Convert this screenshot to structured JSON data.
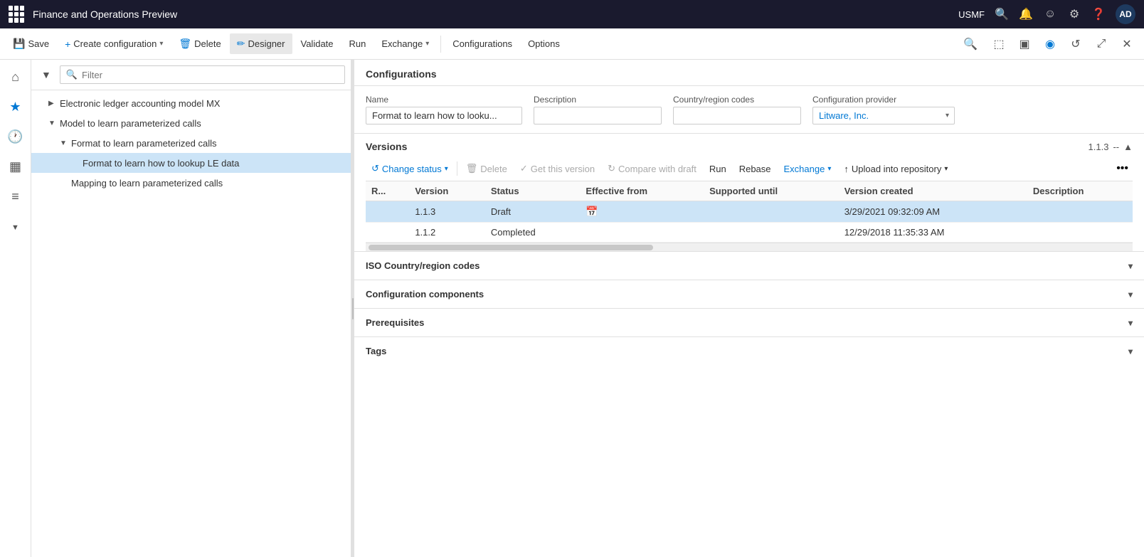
{
  "app": {
    "title": "Finance and Operations Preview",
    "user": "USMF",
    "avatar": "AD"
  },
  "toolbar": {
    "save_label": "Save",
    "create_config_label": "Create configuration",
    "delete_label": "Delete",
    "designer_label": "Designer",
    "validate_label": "Validate",
    "run_label": "Run",
    "exchange_label": "Exchange",
    "configurations_label": "Configurations",
    "options_label": "Options"
  },
  "nav": {
    "filter_placeholder": "Filter",
    "tree": [
      {
        "id": "electronic-ledger",
        "label": "Electronic ledger accounting model MX",
        "level": 1,
        "expanded": false,
        "selected": false
      },
      {
        "id": "model-learn",
        "label": "Model to learn parameterized calls",
        "level": 1,
        "expanded": true,
        "selected": false
      },
      {
        "id": "format-learn",
        "label": "Format to learn parameterized calls",
        "level": 2,
        "expanded": true,
        "selected": false
      },
      {
        "id": "format-lookup",
        "label": "Format to learn how to lookup LE data",
        "level": 3,
        "expanded": false,
        "selected": true
      },
      {
        "id": "mapping-learn",
        "label": "Mapping to learn parameterized calls",
        "level": 2,
        "expanded": false,
        "selected": false
      }
    ]
  },
  "content": {
    "header": "Configurations",
    "form": {
      "name_label": "Name",
      "name_value": "Format to learn how to looku...",
      "description_label": "Description",
      "description_value": "",
      "country_region_label": "Country/region codes",
      "country_region_value": "",
      "config_provider_label": "Configuration provider",
      "config_provider_value": "Litware, Inc."
    },
    "versions": {
      "title": "Versions",
      "badge": "1.1.3",
      "badge_separator": "--",
      "toolbar": {
        "change_status": "Change status",
        "delete": "Delete",
        "get_version": "Get this version",
        "compare_draft": "Compare with draft",
        "run": "Run",
        "rebase": "Rebase",
        "exchange": "Exchange",
        "upload_repo": "Upload into repository"
      },
      "table": {
        "columns": [
          "R...",
          "Version",
          "Status",
          "Effective from",
          "Supported until",
          "Version created",
          "Description"
        ],
        "rows": [
          {
            "r": "",
            "version": "1.1.3",
            "status": "Draft",
            "effective_from": "",
            "supported_until": "",
            "version_created": "3/29/2021 09:32:09 AM",
            "description": "",
            "selected": true
          },
          {
            "r": "",
            "version": "1.1.2",
            "status": "Completed",
            "effective_from": "",
            "supported_until": "",
            "version_created": "12/29/2018 11:35:33 AM",
            "description": "",
            "selected": false
          }
        ]
      }
    },
    "sections": [
      {
        "id": "iso-country",
        "label": "ISO Country/region codes",
        "collapsed": true
      },
      {
        "id": "config-components",
        "label": "Configuration components",
        "collapsed": true
      },
      {
        "id": "prerequisites",
        "label": "Prerequisites",
        "collapsed": true
      },
      {
        "id": "tags",
        "label": "Tags",
        "collapsed": true
      }
    ]
  }
}
